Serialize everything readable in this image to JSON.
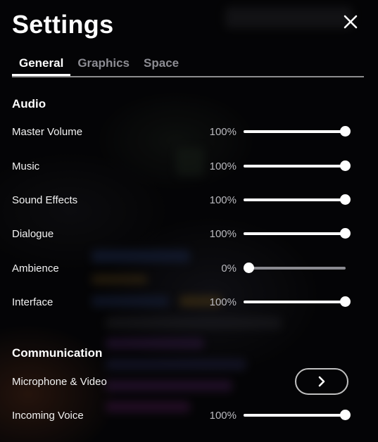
{
  "header": {
    "title": "Settings"
  },
  "tabs": [
    {
      "label": "General",
      "active": true
    },
    {
      "label": "Graphics",
      "active": false
    },
    {
      "label": "Space",
      "active": false
    }
  ],
  "audio": {
    "heading": "Audio",
    "rows": [
      {
        "label": "Master Volume",
        "value_text": "100%",
        "level": 1.0
      },
      {
        "label": "Music",
        "value_text": "100%",
        "level": 1.0
      },
      {
        "label": "Sound Effects",
        "value_text": "100%",
        "level": 1.0
      },
      {
        "label": "Dialogue",
        "value_text": "100%",
        "level": 1.0
      },
      {
        "label": "Ambience",
        "value_text": "0%",
        "level": 0.0
      },
      {
        "label": "Interface",
        "value_text": "100%",
        "level": 1.0
      }
    ]
  },
  "communication": {
    "heading": "Communication",
    "microphone": {
      "label": "Microphone & Video",
      "button_icon": "chevron-right-icon"
    },
    "incoming": {
      "label": "Incoming Voice",
      "value_text": "100%",
      "level": 1.0
    }
  },
  "icons": {
    "close": "close-icon",
    "chevron": "chevron-right-icon"
  },
  "colors": {
    "text": "#ffffff",
    "muted_tab": "#8c8c93",
    "track": "#8a8a90"
  }
}
